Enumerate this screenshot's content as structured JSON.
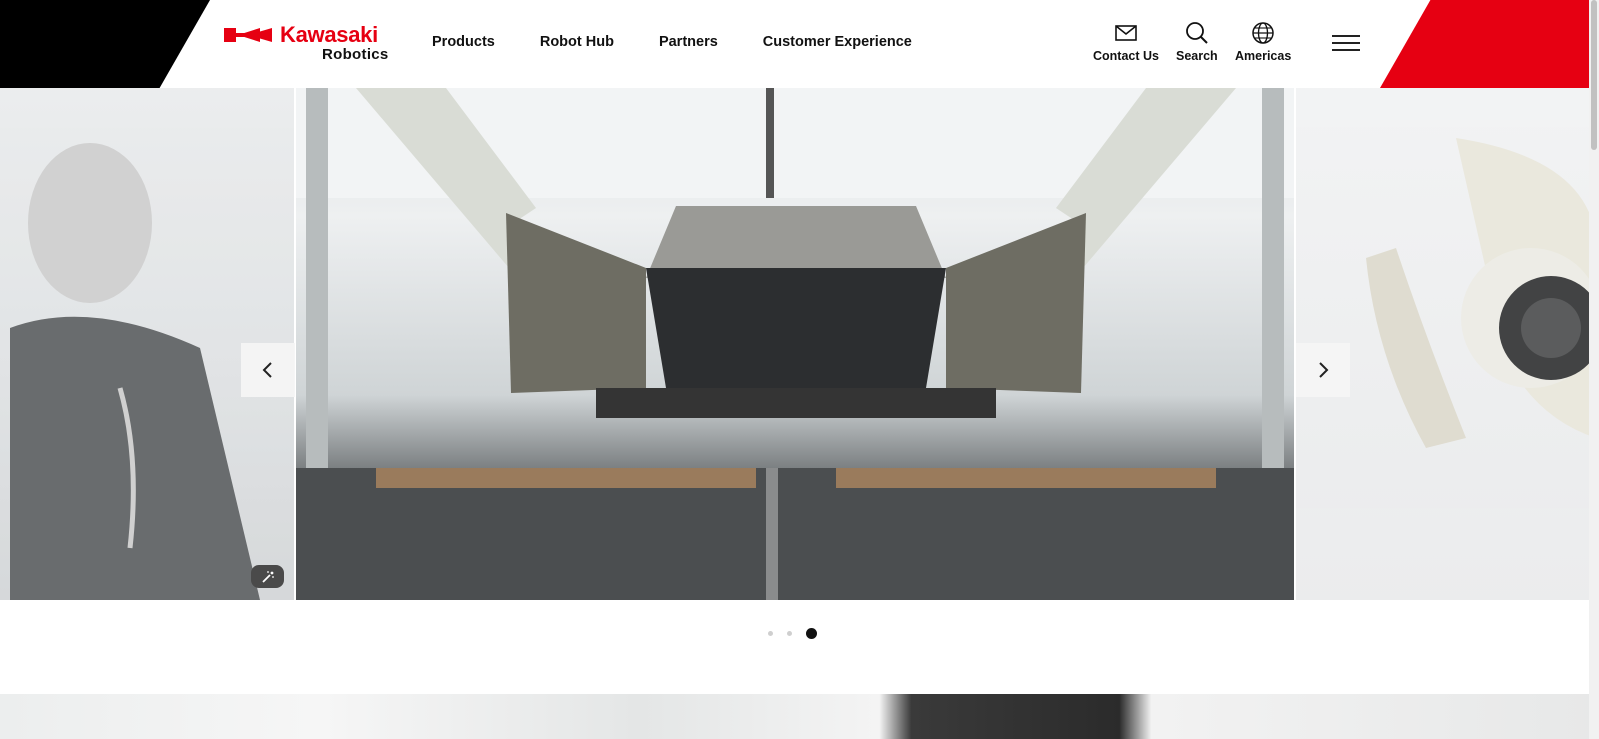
{
  "brand": {
    "name": "Kawasaki",
    "sub": "Robotics",
    "red": "#e60012",
    "black": "#000000"
  },
  "nav": {
    "items": [
      "Products",
      "Robot Hub",
      "Partners",
      "Customer Experience"
    ]
  },
  "utility": {
    "contact": "Contact Us",
    "search": "Search",
    "region": "Americas"
  },
  "carousel": {
    "slide_count": 3,
    "active_index": 2
  }
}
